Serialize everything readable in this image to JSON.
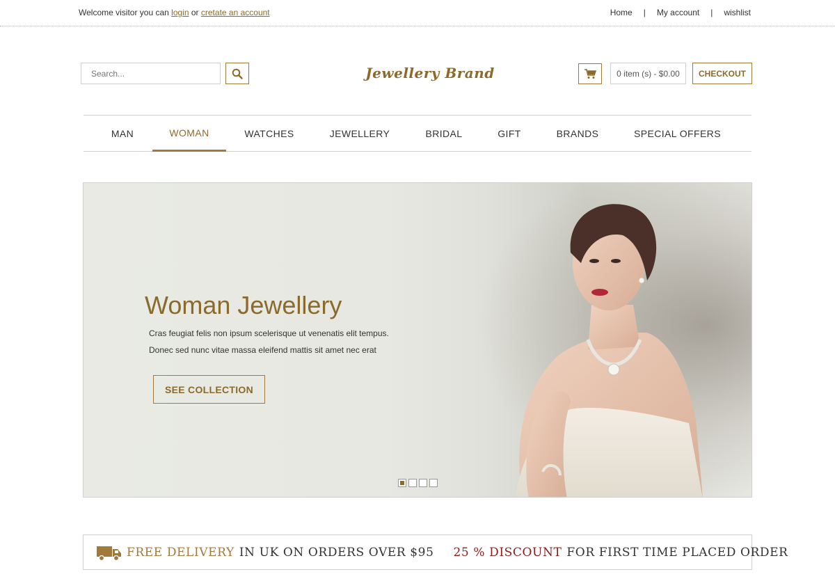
{
  "topbar": {
    "welcome_prefix": "Welcome visitor you can",
    "login_label": "login",
    "or_text": "or",
    "create_account_label": "cretate an account",
    "links": [
      {
        "label": "Home"
      },
      {
        "label": "My account"
      },
      {
        "label": "wishlist"
      }
    ],
    "separator": "|"
  },
  "header": {
    "search_placeholder": "Search...",
    "logo_text": "Jewellery Brand",
    "cart_summary": "0 item (s) - $0.00",
    "checkout_label": "CHECKOUT"
  },
  "nav": {
    "items": [
      {
        "label": "MAN",
        "active": false
      },
      {
        "label": "WOMAN",
        "active": true
      },
      {
        "label": "WATCHES",
        "active": false
      },
      {
        "label": "JEWELLERY",
        "active": false
      },
      {
        "label": "BRIDAL",
        "active": false
      },
      {
        "label": "GIFT",
        "active": false
      },
      {
        "label": "BRANDS",
        "active": false
      },
      {
        "label": "SPECIAL OFFERS",
        "active": false
      }
    ]
  },
  "slider": {
    "title": "Woman Jewellery",
    "text_line1": "Cras feugiat felis non ipsum scelerisque ut venenatis elit tempus.",
    "text_line2": "Donec sed nunc vitae massa eleifend mattis sit amet nec erat",
    "button_label": "SEE COLLECTION",
    "slide_count": 4,
    "active_slide": 1
  },
  "promo": {
    "free_delivery": "FREE DELIVERY",
    "delivery_rest": "IN UK ON ORDERS OVER $95",
    "discount": "25 % DISCOUNT",
    "discount_rest": "FOR FIRST TIME PLACED ORDER"
  },
  "colors": {
    "accent": "#8b6a2b",
    "border": "#cfcfcf",
    "discount_red": "#8e1a1a"
  },
  "icons": {
    "search": "search-icon",
    "cart": "cart-icon",
    "truck": "truck-icon"
  }
}
